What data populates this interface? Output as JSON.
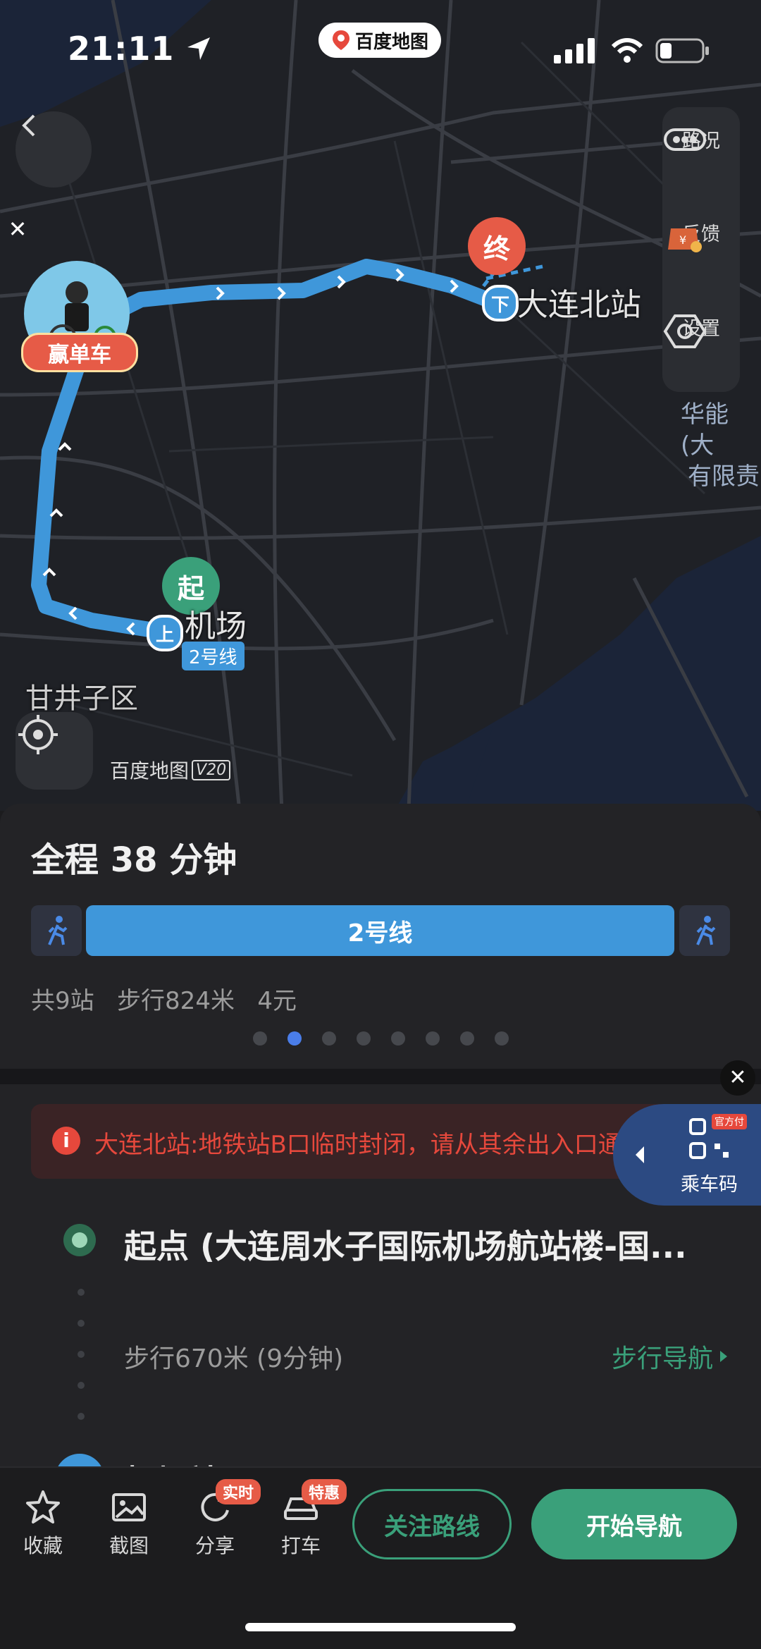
{
  "status_bar": {
    "time": "21:11",
    "app_badge": "百度地图"
  },
  "map": {
    "side_panel": [
      {
        "label": "路况",
        "icon": "traffic-icon"
      },
      {
        "label": "反馈",
        "icon": "feedback-icon"
      },
      {
        "label": "设置",
        "icon": "settings-icon"
      }
    ],
    "promo_label": "赢单车",
    "end_marker": "终",
    "start_marker": "起",
    "end_station_tag": "下",
    "end_station": "大连北站",
    "start_station_tag": "上",
    "start_station": "机场",
    "line_tag": "2号线",
    "district": "甘井子区",
    "poi_line1": "华能(大",
    "poi_line2": "有限责",
    "watermark": "百度地图",
    "watermark_version": "V20"
  },
  "summary": {
    "total_time": "全程 38 分钟",
    "line_name": "2号线",
    "stats": "共9站   步行824米   4元",
    "page_count": 8,
    "active_page": 1
  },
  "alert": {
    "text": "大连北站:地铁站B口临时封闭，请从其余出入口通行"
  },
  "qr": {
    "label": "乘车码",
    "tag": "官方付"
  },
  "steps": {
    "start": "起点 (大连周水子国际机场航站楼-国...",
    "walk": "步行670米 (9分钟)",
    "walk_nav": "步行导航",
    "next_partial": "机场站(A口)"
  },
  "toolbar": {
    "favorite": "收藏",
    "screenshot": "截图",
    "share": "分享",
    "share_tag": "实时",
    "taxi": "打车",
    "taxi_tag": "特惠",
    "follow": "关注路线",
    "start_nav": "开始导航"
  },
  "colors": {
    "route": "#3f97da",
    "accent_green": "#3aa07a",
    "end_red": "#e65b47",
    "alert_red": "#e6483c"
  }
}
